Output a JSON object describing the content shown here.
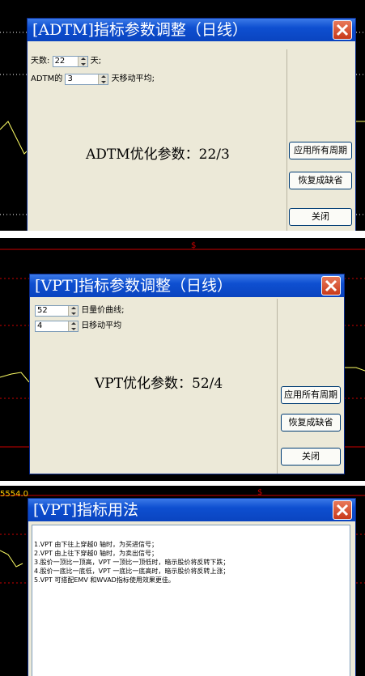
{
  "colors": {
    "title_bar": "#0e4fd0",
    "dialog_bg": "#ece9d8",
    "chart_bg": "#000000",
    "grid_red": "#cc0000",
    "close_red": "#d04a2a"
  },
  "dialog1": {
    "title": "[ADTM]指标参数调整（日线）",
    "row1": {
      "label": "天数:",
      "value": "22",
      "suffix": "天;"
    },
    "row2": {
      "label": "ADTM的",
      "value": "3",
      "suffix": "天移动平均;"
    },
    "optimized": "ADTM优化参数：22/3",
    "buttons": {
      "apply_all": "应用所有周期",
      "restore_default": "恢复成缺省",
      "close": "关闭"
    }
  },
  "dialog2": {
    "title": "[VPT]指标参数调整（日线）",
    "row1": {
      "value": "52",
      "suffix": "日量价曲线;"
    },
    "row2": {
      "value": "4",
      "suffix": "日移动平均"
    },
    "optimized": "VPT优化参数：52/4",
    "buttons": {
      "apply_all": "应用所有周期",
      "restore_default": "恢复成缺省",
      "close": "关闭"
    }
  },
  "dialog3": {
    "title": "[VPT]指标用法",
    "lines": [
      "1.VPT 由下往上穿越0 轴时，为买进信号；",
      "2.VPT 由上往下穿越0 轴时，为卖出信号；",
      "3.股价一顶比一顶高，VPT 一顶比一顶低时，暗示股价将反转下跌；",
      "4.股价一底比一底低，VPT 一底比一底高时，暗示股价将反转上涨；",
      "5.VPT 可搭配EMV 和WVAD指标使用效果更佳。"
    ]
  },
  "background": {
    "panel3_axis_value": "5554.0"
  }
}
